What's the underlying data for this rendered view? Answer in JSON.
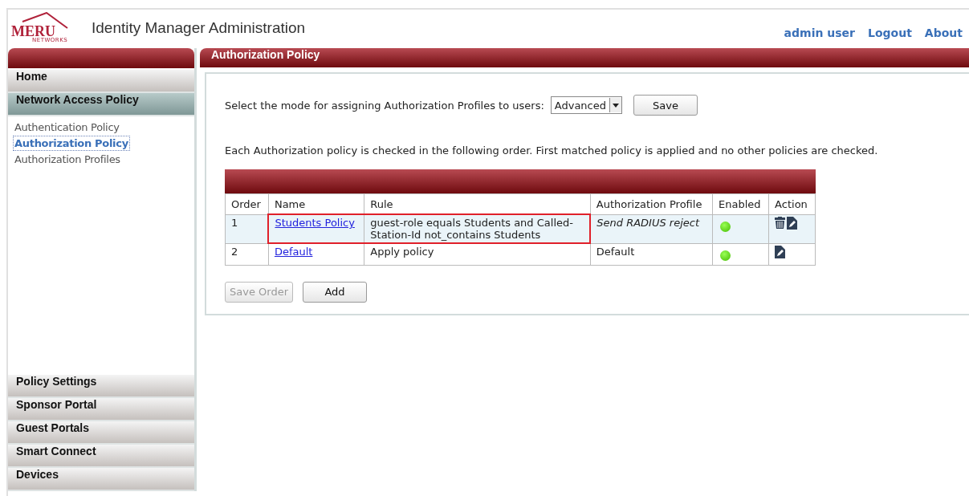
{
  "header": {
    "logo_word": "MERU",
    "logo_sub": "NETWORKS",
    "title": "Identity Manager Administration",
    "links": [
      "admin user",
      "Logout",
      "About"
    ]
  },
  "sidebar": {
    "sections": [
      {
        "label": "Home",
        "selected": false
      },
      {
        "label": "Network Access Policy",
        "selected": true,
        "children": [
          {
            "label": "Authentication Policy",
            "selected": false
          },
          {
            "label": "Authorization Policy",
            "selected": true
          },
          {
            "label": "Authorization Profiles",
            "selected": false
          }
        ]
      }
    ],
    "bottom_sections": [
      {
        "label": "Policy Settings"
      },
      {
        "label": "Sponsor Portal"
      },
      {
        "label": "Guest Portals"
      },
      {
        "label": "Smart Connect"
      },
      {
        "label": "Devices"
      }
    ]
  },
  "main": {
    "title": "Authorization Policy",
    "mode_label": "Select the mode for assigning Authorization Profiles to users:",
    "mode_value": "Advanced",
    "save_button": "Save",
    "note": "Each Authorization policy is checked in the following order. First matched policy is applied and no other policies are checked.",
    "table": {
      "columns": [
        "Order",
        "Name",
        "Rule",
        "Authorization Profile",
        "Enabled",
        "Action"
      ],
      "rows": [
        {
          "order": "1",
          "name": "Students Policy",
          "rule": "guest-role equals Students and Called-Station-Id not_contains Students",
          "profile": "Send RADIUS reject",
          "profile_italic": true,
          "enabled": true,
          "deletable": true,
          "highlighted": true
        },
        {
          "order": "2",
          "name": "Default",
          "rule": "Apply policy",
          "profile": "Default",
          "profile_italic": false,
          "enabled": true,
          "deletable": false,
          "highlighted": false
        }
      ]
    },
    "buttons": [
      {
        "label": "Save Order",
        "disabled": true
      },
      {
        "label": "Add",
        "disabled": false
      }
    ]
  }
}
